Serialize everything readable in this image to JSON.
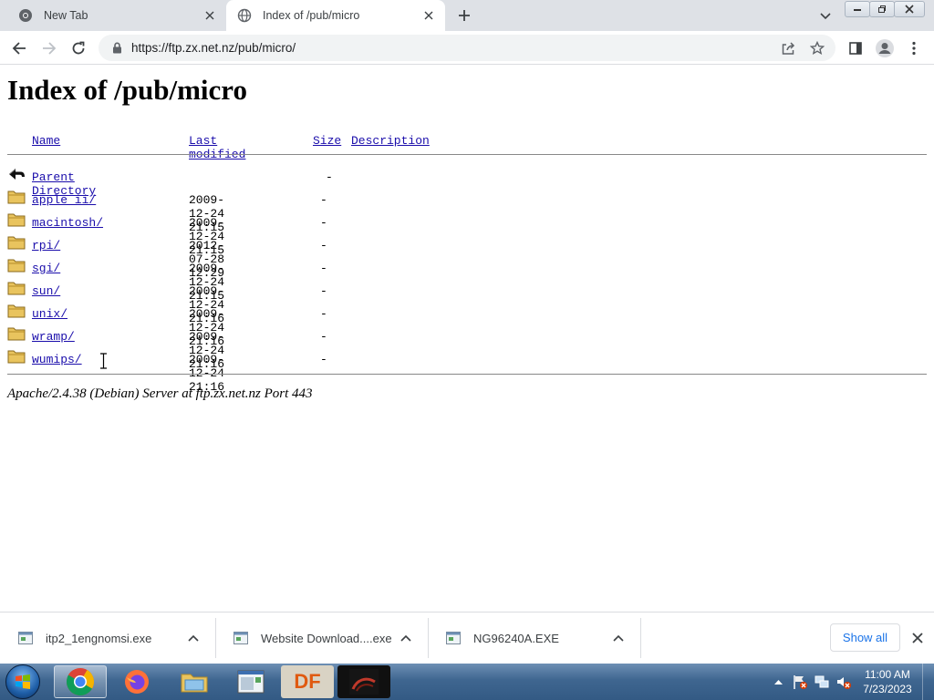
{
  "browser": {
    "tabs": [
      {
        "title": "New Tab",
        "active": false
      },
      {
        "title": "Index of /pub/micro",
        "active": true
      }
    ],
    "url": "https://ftp.zx.net.nz/pub/micro/"
  },
  "page": {
    "title": "Index of /pub/micro",
    "columns": {
      "name": "Name",
      "modified": "Last modified",
      "size": "Size",
      "description": "Description"
    },
    "parent": {
      "name": "Parent Directory",
      "size": "-"
    },
    "entries": [
      {
        "name": "apple_ii/",
        "modified": "2009-12-24 21:15",
        "size": "-"
      },
      {
        "name": "macintosh/",
        "modified": "2009-12-24 21:15",
        "size": "-"
      },
      {
        "name": "rpi/",
        "modified": "2012-07-28 12:29",
        "size": "-"
      },
      {
        "name": "sgi/",
        "modified": "2009-12-24 21:15",
        "size": "-"
      },
      {
        "name": "sun/",
        "modified": "2009-12-24 21:16",
        "size": "-"
      },
      {
        "name": "unix/",
        "modified": "2009-12-24 21:16",
        "size": "-"
      },
      {
        "name": "wramp/",
        "modified": "2009-12-24 21:16",
        "size": "-"
      },
      {
        "name": "wumips/",
        "modified": "2009-12-24 21:16",
        "size": "-"
      }
    ],
    "server_signature": "Apache/2.4.38 (Debian) Server at ftp.zx.net.nz Port 443"
  },
  "downloads": {
    "items": [
      {
        "filename": "itp2_1engnomsi.exe"
      },
      {
        "filename": "Website Download....exe"
      },
      {
        "filename": "NG96240A.EXE"
      }
    ],
    "show_all_label": "Show all"
  },
  "taskbar": {
    "time": "11:00 AM",
    "date": "7/23/2023",
    "df_label": "DF"
  }
}
